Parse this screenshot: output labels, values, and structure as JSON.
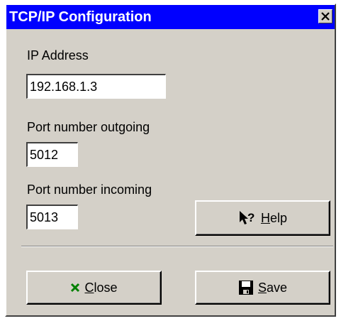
{
  "window": {
    "title": "TCP/IP Configuration",
    "close_icon": "close-x-icon"
  },
  "ip": {
    "label": "IP Address",
    "value": "192.168.1.3"
  },
  "port_out": {
    "label": "Port number outgoing",
    "value": "5012"
  },
  "port_in": {
    "label": "Port number incoming",
    "value": "5013"
  },
  "buttons": {
    "help": {
      "mnemonic": "H",
      "rest": "elp",
      "icon": "help-pointer-icon"
    },
    "close": {
      "mnemonic": "C",
      "rest": "lose",
      "icon": "close-x-icon",
      "icon_color": "#008000"
    },
    "save": {
      "mnemonic": "S",
      "rest": "ave",
      "icon": "floppy-disk-icon",
      "icon_color": "#000000"
    }
  },
  "colors": {
    "titlebar": "#0000ff",
    "face": "#d4d0c8"
  }
}
